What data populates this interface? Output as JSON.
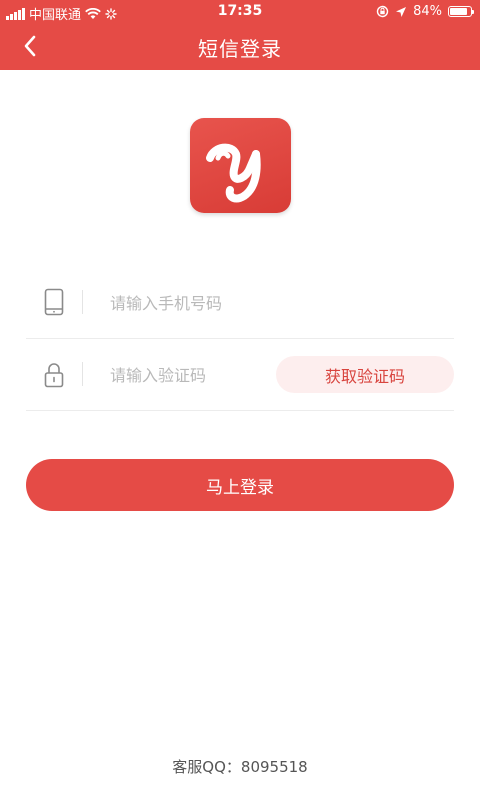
{
  "status_bar": {
    "carrier": "中国联通",
    "time": "17:35",
    "battery_text": "84%",
    "battery_level": 0.84
  },
  "nav": {
    "back_icon": "chevron-left-icon",
    "title": "短信登录"
  },
  "logo": {
    "icon": "app-logo-y"
  },
  "form": {
    "phone_placeholder": "请输入手机号码",
    "phone_value": "",
    "code_placeholder": "请输入验证码",
    "code_value": "",
    "get_code_label": "获取验证码"
  },
  "login_button_label": "马上登录",
  "footer": {
    "customer_service": "客服QQ：8095518"
  },
  "colors": {
    "brand": "#e54b46",
    "code_button_bg": "#fdeeee",
    "code_button_text": "#d8443e",
    "placeholder": "#b9b9b9"
  }
}
